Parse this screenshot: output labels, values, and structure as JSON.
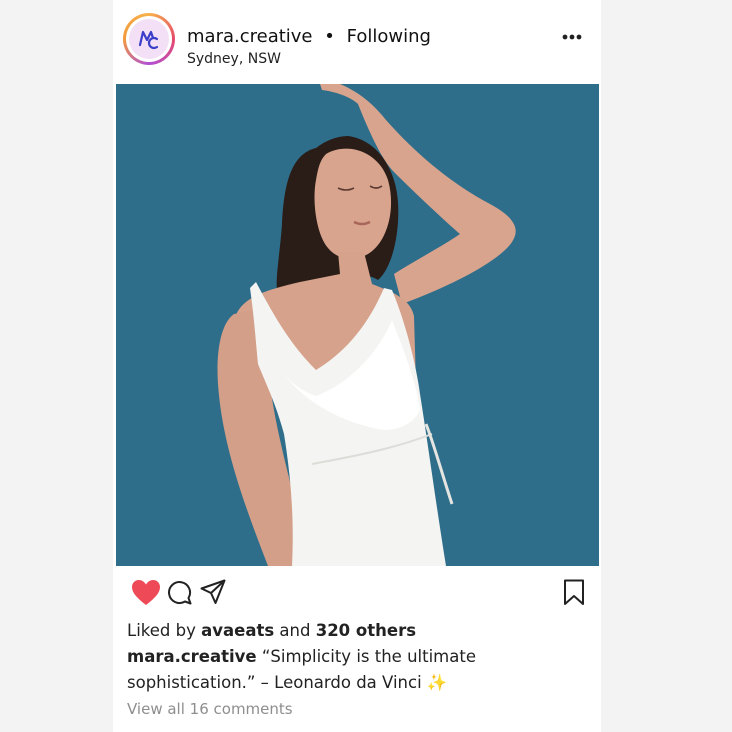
{
  "post": {
    "username": "mara.creative",
    "separator": "•",
    "following_label": "Following",
    "location": "Sydney, NSW",
    "likes": {
      "prefix": "Liked by",
      "user": "avaeats",
      "middle": "and",
      "others": "320 others"
    },
    "caption": {
      "author": "mara.creative",
      "text": "“Simplicity is the ultimate sophistication.” – Leonardo da Vinci",
      "emoji": "✨"
    },
    "view_comments": "View all 16 comments",
    "liked": true
  },
  "colors": {
    "like": "#ed4956",
    "photo_background": "#2f6e8b",
    "muted_text": "#8e8e8e"
  },
  "icons": [
    "avatar-logo-icon",
    "more-options-icon",
    "heart-icon",
    "comment-icon",
    "share-icon",
    "bookmark-icon"
  ]
}
